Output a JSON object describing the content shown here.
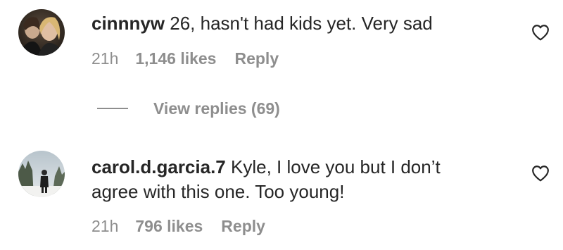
{
  "comments": [
    {
      "username": "cinnnyw",
      "text_line1": " 26, hasn't had kids yet. Very sad",
      "text_line2": "",
      "time": "21h",
      "likes": "1,146 likes",
      "reply_label": "Reply",
      "like_icon": "heart-icon"
    },
    {
      "username": "carol.d.garcia.7",
      "text_line1": " Kyle, I love you but I don’t",
      "text_line2": "agree with this one. Too young!",
      "time": "21h",
      "likes": "796 likes",
      "reply_label": "Reply",
      "like_icon": "heart-icon"
    }
  ],
  "view_replies": {
    "label": "View replies (69)"
  },
  "colors": {
    "text": "#262626",
    "secondary": "#8e8e8e",
    "background": "#ffffff"
  }
}
